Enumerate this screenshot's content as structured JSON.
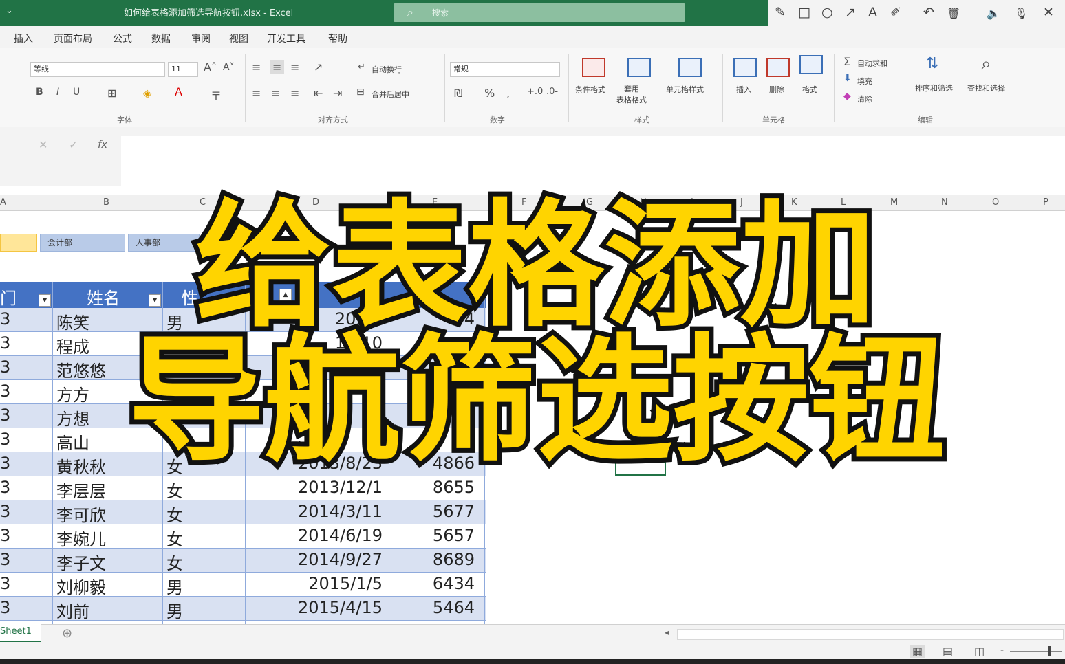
{
  "titlebar": {
    "filename": "如何给表格添加筛选导航按钮.xlsx - Excel",
    "search_placeholder": "搜索",
    "search_icon": "search-icon",
    "pen_tools": [
      "✎",
      "□",
      "○",
      "↗",
      "A",
      "✐",
      "↶",
      "🗑",
      "🔈",
      "🎙",
      "✕"
    ]
  },
  "tabs": [
    "插入",
    "页面布局",
    "公式",
    "数据",
    "审阅",
    "视图",
    "开发工具",
    "帮助"
  ],
  "ribbon": {
    "font_name": "等线",
    "font_size": "11",
    "wrap_text": "自动换行",
    "merge_center": "合并后居中",
    "number_format": "常规",
    "groups": {
      "font": "字体",
      "alignment": "对齐方式",
      "number": "数字",
      "styles": "样式",
      "cells": "单元格",
      "editing": "编辑"
    },
    "styles_buttons": [
      "条件格式",
      "套用\n表格格式",
      "单元格样式"
    ],
    "cells_buttons": [
      "插入",
      "删除",
      "格式"
    ],
    "editing_buttons": {
      "autosum": "自动求和",
      "fill": "填充",
      "clear": "清除",
      "sort_filter": "排序和筛选",
      "find_select": "查找和选择"
    }
  },
  "formula_bar": {
    "fx": "fx"
  },
  "columns": [
    "A",
    "B",
    "C",
    "D",
    "E",
    "F",
    "G",
    "H",
    "I",
    "J",
    "K",
    "L",
    "M",
    "N",
    "O",
    "P"
  ],
  "slicers": [
    "会计部",
    "人事部"
  ],
  "table": {
    "headers": [
      "门",
      "姓名",
      "性"
    ],
    "rows": [
      {
        "dept": "3",
        "name": "陈笑",
        "gender": "男",
        "date": "2012/",
        "salary": "4"
      },
      {
        "dept": "3",
        "name": "程成",
        "gender": "",
        "date": "12/10",
        "salary": ""
      },
      {
        "dept": "3",
        "name": "范悠悠",
        "gender": "",
        "date": "",
        "salary": ""
      },
      {
        "dept": "3",
        "name": "方方",
        "gender": "",
        "date": "",
        "salary": ""
      },
      {
        "dept": "3",
        "name": "方想",
        "gender": "",
        "date": "",
        "salary": ""
      },
      {
        "dept": "3",
        "name": "高山",
        "gender": "",
        "date": "",
        "salary": ""
      },
      {
        "dept": "3",
        "name": "黄秋秋",
        "gender": "女",
        "date": "2013/8/23",
        "salary": "4866"
      },
      {
        "dept": "3",
        "name": "李层层",
        "gender": "女",
        "date": "2013/12/1",
        "salary": "8655"
      },
      {
        "dept": "3",
        "name": "李可欣",
        "gender": "女",
        "date": "2014/3/11",
        "salary": "5677"
      },
      {
        "dept": "3",
        "name": "李婉儿",
        "gender": "女",
        "date": "2014/6/19",
        "salary": "5657"
      },
      {
        "dept": "3",
        "name": "李子文",
        "gender": "女",
        "date": "2014/9/27",
        "salary": "8689"
      },
      {
        "dept": "3",
        "name": "刘柳毅",
        "gender": "男",
        "date": "2015/1/5",
        "salary": "6434"
      },
      {
        "dept": "3",
        "name": "刘前",
        "gender": "男",
        "date": "2015/4/15",
        "salary": "5464"
      }
    ]
  },
  "sheet_tab": "Sheet1",
  "caption": {
    "line1": "给表格添加",
    "line2": "导航筛选按钮"
  },
  "colors": {
    "excel_green": "#217346",
    "table_header": "#4472c4",
    "band": "#d9e1f2",
    "caption": "#ffd400"
  }
}
